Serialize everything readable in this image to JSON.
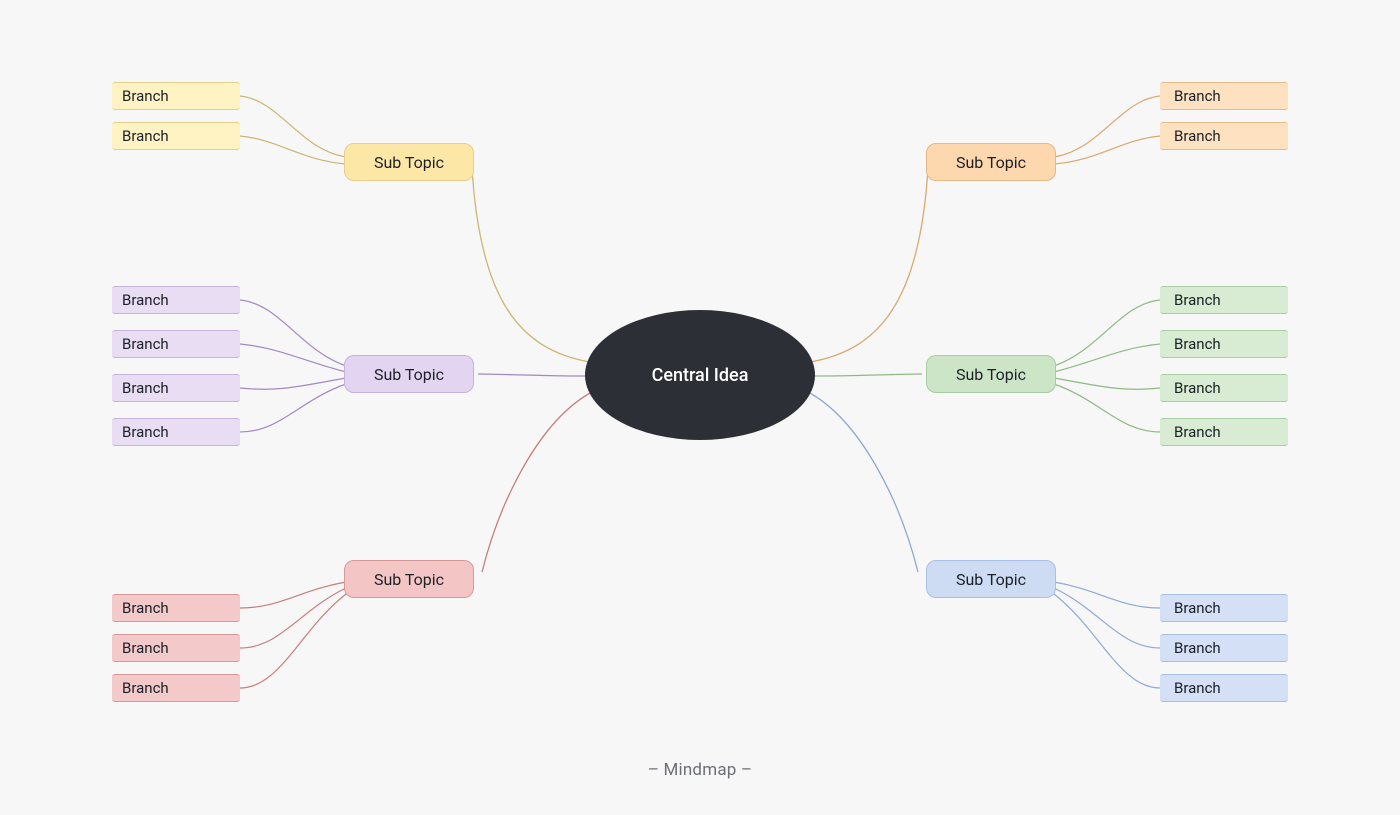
{
  "caption": "– Mindmap –",
  "central": "Central Idea",
  "sub_label": "Sub Topic",
  "branch_label": "Branch",
  "colors": {
    "yellow_line": "#ccb574",
    "purple_line": "#a488c2",
    "pink_line": "#c97d7d",
    "orange_line": "#d9a96e",
    "green_line": "#8fb985",
    "blue_line": "#8fa9d1"
  },
  "subs": {
    "yellow": {
      "branches": 2,
      "side": "left"
    },
    "purple": {
      "branches": 4,
      "side": "left"
    },
    "pink": {
      "branches": 3,
      "side": "left"
    },
    "orange": {
      "branches": 2,
      "side": "right"
    },
    "green": {
      "branches": 4,
      "side": "right"
    },
    "blue": {
      "branches": 3,
      "side": "right"
    }
  }
}
